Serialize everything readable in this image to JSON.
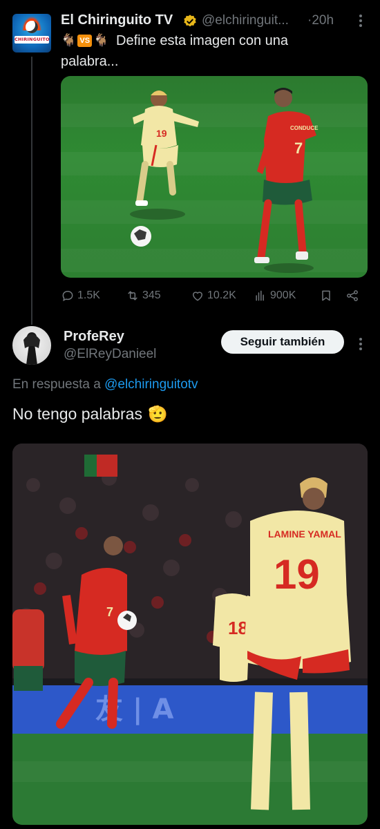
{
  "tweet": {
    "avatar_text": "CHIRINGUITO",
    "author_name": "El Chiringuito TV",
    "author_handle": "@elchiringuit...",
    "time": "20h",
    "more_icon": "more-dots-icon",
    "emoji_left": "🐐",
    "vs_label": "VS",
    "emoji_right": "🐐",
    "text_line1": "Define esta imagen con una",
    "text_line2": "palabra...",
    "stats": {
      "replies": "1.5K",
      "reposts": "345",
      "likes": "10.2K",
      "views": "900K"
    },
    "image_jersey_back": "CONDUCE",
    "player_left_number": "19",
    "player_right_number": "7"
  },
  "reply": {
    "author_name": "ProfeRey",
    "author_handle": "@ElReyDanieel",
    "follow_label": "Seguir también",
    "reply_to_label": "En respuesta a",
    "reply_to_handle": "@elchiringuitotv",
    "text": "No tengo palabras",
    "emoji": "🫡",
    "image_jersey_name": "LAMINE YAMAL",
    "image_jersey_number": "19",
    "image_number_18": "18",
    "image_number_7": "7",
    "banner_text": "友 | A"
  },
  "colors": {
    "background": "#000000",
    "text_primary": "#e7e9ea",
    "text_secondary": "#71767b",
    "link": "#1d9bf0",
    "verified": "#e8b71a",
    "divider": "#333639",
    "spain_yellow": "#f2e7a6",
    "portugal_red": "#d62a22"
  }
}
